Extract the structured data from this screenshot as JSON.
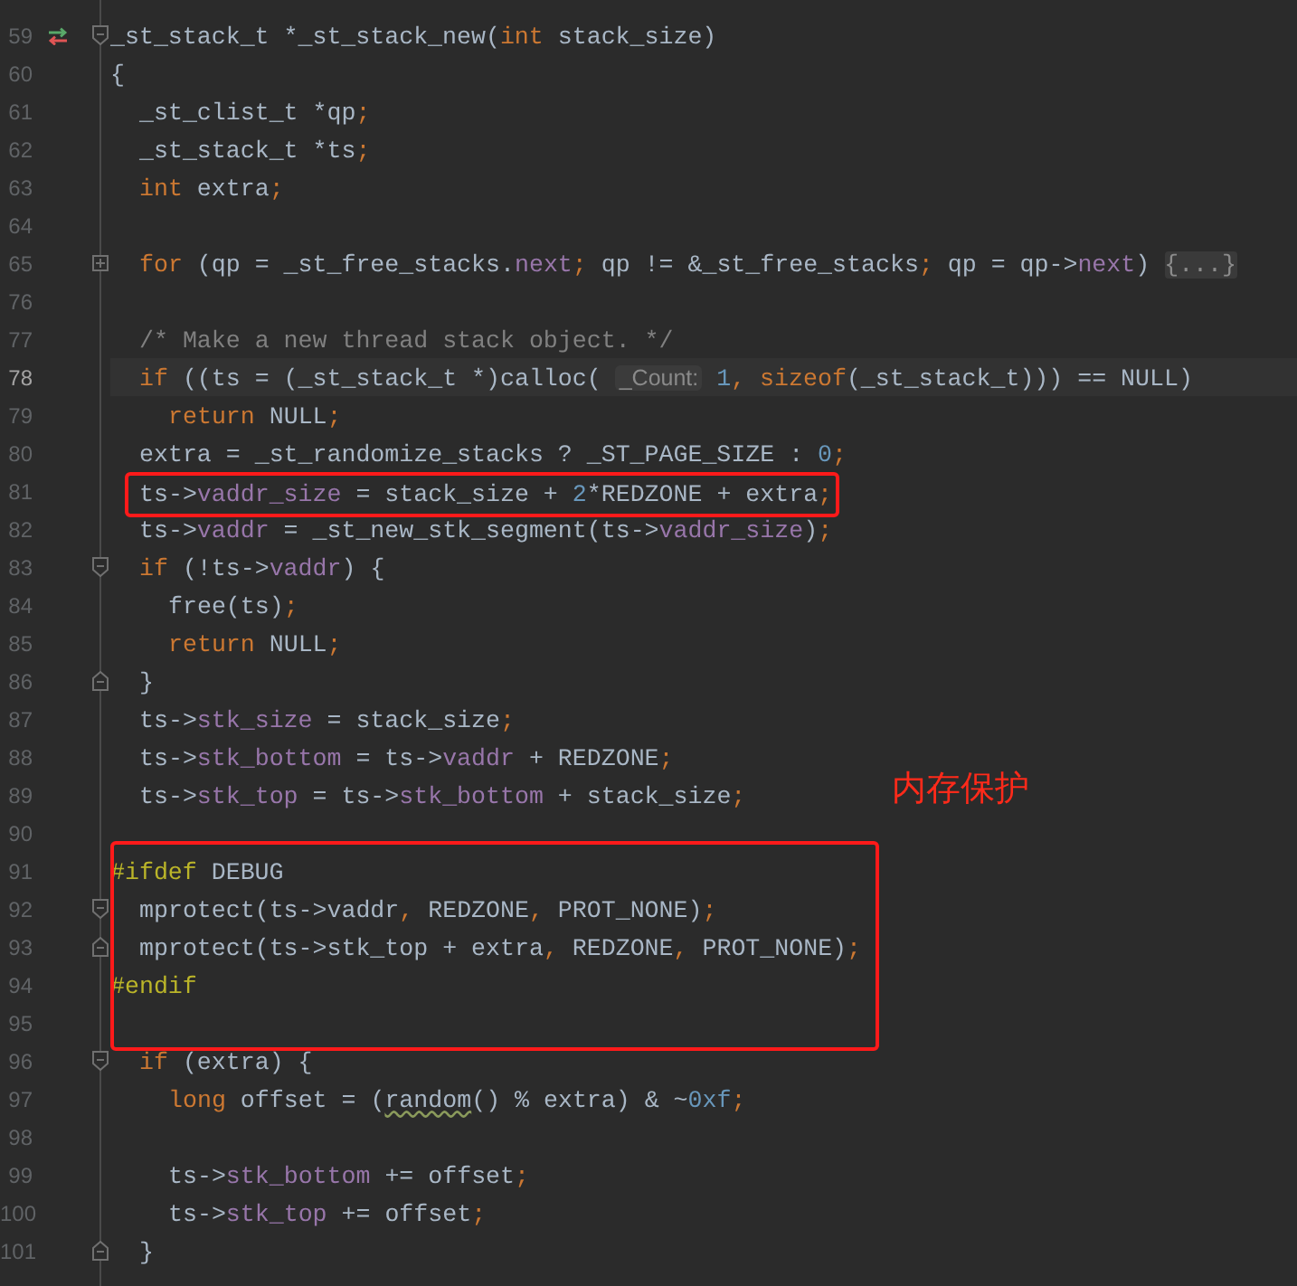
{
  "editor": {
    "groups": [
      {
        "kind": "plain",
        "lines": [
          {
            "number": "59",
            "gutter_icon": {
              "kind": "swap"
            },
            "fold": {
              "kind": "start"
            },
            "current": false,
            "tokens": [
              {
                "kind": "p",
                "text": "_st_stack_t *_st_stack_new("
              },
              {
                "kind": "kw",
                "text": "int"
              },
              {
                "kind": "p",
                "text": " stack_size)"
              }
            ]
          },
          {
            "number": "60",
            "current": false,
            "tokens": [
              {
                "kind": "p",
                "text": "{"
              }
            ]
          },
          {
            "number": "61",
            "current": false,
            "tokens": [
              {
                "kind": "p",
                "text": "  _st_clist_t *qp"
              },
              {
                "kind": "kw",
                "text": ";"
              }
            ]
          },
          {
            "number": "62",
            "current": false,
            "tokens": [
              {
                "kind": "p",
                "text": "  _st_stack_t *ts"
              },
              {
                "kind": "kw",
                "text": ";"
              }
            ]
          },
          {
            "number": "63",
            "current": false,
            "tokens": [
              {
                "kind": "kw",
                "text": "  int"
              },
              {
                "kind": "p",
                "text": " extra"
              },
              {
                "kind": "kw",
                "text": ";"
              }
            ]
          },
          {
            "number": "64",
            "current": false
          },
          {
            "number": "65",
            "fold": {
              "kind": "collapsed"
            },
            "current": false,
            "tokens": [
              {
                "kind": "kw",
                "text": "  for"
              },
              {
                "kind": "p",
                "text": " (qp = _st_free_stacks."
              },
              {
                "kind": "f",
                "text": "next"
              },
              {
                "kind": "kw",
                "text": ";"
              },
              {
                "kind": "p",
                "text": " qp != &_st_free_stacks"
              },
              {
                "kind": "kw",
                "text": ";"
              },
              {
                "kind": "p",
                "text": " qp = qp->"
              },
              {
                "kind": "f",
                "text": "next"
              },
              {
                "kind": "p",
                "text": ") "
              },
              {
                "kind": "ph",
                "text": "{...}"
              }
            ]
          },
          {
            "number": "76",
            "current": false
          },
          {
            "number": "77",
            "current": false,
            "tokens": [
              {
                "kind": "c",
                "text": "  /* Make a new thread stack object. */"
              }
            ]
          },
          {
            "number": "78",
            "current": true,
            "tokens": [
              {
                "kind": "kw",
                "text": "  if"
              },
              {
                "kind": "p",
                "text": " ((ts = (_st_stack_t *)calloc( "
              },
              {
                "kind": "h",
                "text": "_Count:"
              },
              {
                "kind": "n",
                "text": " 1"
              },
              {
                "kind": "kw",
                "text": ","
              },
              {
                "kind": "kw",
                "text": " sizeof"
              },
              {
                "kind": "p",
                "text": "(_st_stack_t))) == NULL)"
              }
            ]
          },
          {
            "number": "79",
            "current": false,
            "tokens": [
              {
                "kind": "kw",
                "text": "    return"
              },
              {
                "kind": "p",
                "text": " NULL"
              },
              {
                "kind": "kw",
                "text": ";"
              }
            ]
          },
          {
            "number": "80",
            "current": false,
            "tokens": [
              {
                "kind": "p",
                "text": "  extra = _st_randomize_stacks ? _ST_PAGE_SIZE : "
              },
              {
                "kind": "n",
                "text": "0"
              },
              {
                "kind": "kw",
                "text": ";"
              }
            ]
          }
        ]
      },
      {
        "kind": "boxed_line",
        "lines": [
          {
            "number": "81",
            "current": false,
            "tokens": [
              {
                "kind": "p",
                "text": "  ts->"
              },
              {
                "kind": "f",
                "text": "vaddr_size"
              },
              {
                "kind": "p",
                "text": " = stack_size + "
              },
              {
                "kind": "n",
                "text": "2"
              },
              {
                "kind": "p",
                "text": "*REDZONE + extra"
              },
              {
                "kind": "kw",
                "text": ";"
              }
            ]
          }
        ]
      },
      {
        "kind": "plain",
        "lines": [
          {
            "number": "82",
            "current": false,
            "tokens": [
              {
                "kind": "p",
                "text": "  ts->"
              },
              {
                "kind": "f",
                "text": "vaddr"
              },
              {
                "kind": "p",
                "text": " = _st_new_stk_segment(ts->"
              },
              {
                "kind": "f",
                "text": "vaddr_size"
              },
              {
                "kind": "p",
                "text": ")"
              },
              {
                "kind": "kw",
                "text": ";"
              }
            ]
          },
          {
            "number": "83",
            "fold": {
              "kind": "start"
            },
            "current": false,
            "tokens": [
              {
                "kind": "kw",
                "text": "  if"
              },
              {
                "kind": "p",
                "text": " (!ts->"
              },
              {
                "kind": "f",
                "text": "vaddr"
              },
              {
                "kind": "p",
                "text": ") {"
              }
            ]
          },
          {
            "number": "84",
            "current": false,
            "tokens": [
              {
                "kind": "p",
                "text": "    free(ts)"
              },
              {
                "kind": "kw",
                "text": ";"
              }
            ]
          },
          {
            "number": "85",
            "current": false,
            "tokens": [
              {
                "kind": "kw",
                "text": "    return"
              },
              {
                "kind": "p",
                "text": " NULL"
              },
              {
                "kind": "kw",
                "text": ";"
              }
            ]
          },
          {
            "number": "86",
            "fold": {
              "kind": "end"
            },
            "current": false,
            "tokens": [
              {
                "kind": "p",
                "text": "  }"
              }
            ]
          },
          {
            "number": "87",
            "current": false,
            "tokens": [
              {
                "kind": "p",
                "text": "  ts->"
              },
              {
                "kind": "f",
                "text": "stk_size"
              },
              {
                "kind": "p",
                "text": " = stack_size"
              },
              {
                "kind": "kw",
                "text": ";"
              }
            ]
          },
          {
            "number": "88",
            "current": false,
            "tokens": [
              {
                "kind": "p",
                "text": "  ts->"
              },
              {
                "kind": "f",
                "text": "stk_bottom"
              },
              {
                "kind": "p",
                "text": " = ts->"
              },
              {
                "kind": "f",
                "text": "vaddr"
              },
              {
                "kind": "p",
                "text": " + REDZONE"
              },
              {
                "kind": "kw",
                "text": ";"
              }
            ]
          },
          {
            "number": "89",
            "current": false,
            "note": "内存保护",
            "tokens": [
              {
                "kind": "p",
                "text": "  ts->"
              },
              {
                "kind": "f",
                "text": "stk_top"
              },
              {
                "kind": "p",
                "text": " = ts->"
              },
              {
                "kind": "f",
                "text": "stk_bottom"
              },
              {
                "kind": "p",
                "text": " + stack_size"
              },
              {
                "kind": "kw",
                "text": ";"
              }
            ]
          },
          {
            "number": "90",
            "current": false
          }
        ]
      },
      {
        "kind": "boxed_block",
        "lines": [
          {
            "number": "91",
            "current": false,
            "tokens": [
              {
                "kind": "m",
                "text": "#ifdef"
              },
              {
                "kind": "p",
                "text": " DEBUG"
              }
            ]
          },
          {
            "number": "92",
            "fold": {
              "kind": "start"
            },
            "current": false,
            "tokens": [
              {
                "kind": "p",
                "text": "  mprotect(ts->vaddr"
              },
              {
                "kind": "kw",
                "text": ","
              },
              {
                "kind": "p",
                "text": " REDZONE"
              },
              {
                "kind": "kw",
                "text": ","
              },
              {
                "kind": "p",
                "text": " PROT_NONE)"
              },
              {
                "kind": "kw",
                "text": ";"
              }
            ]
          },
          {
            "number": "93",
            "fold": {
              "kind": "end"
            },
            "current": false,
            "tokens": [
              {
                "kind": "p",
                "text": "  mprotect(ts->stk_top + extra"
              },
              {
                "kind": "kw",
                "text": ","
              },
              {
                "kind": "p",
                "text": " REDZONE"
              },
              {
                "kind": "kw",
                "text": ","
              },
              {
                "kind": "p",
                "text": " PROT_NONE)"
              },
              {
                "kind": "kw",
                "text": ";"
              }
            ]
          },
          {
            "number": "94",
            "current": false,
            "tokens": [
              {
                "kind": "m",
                "text": "#endif"
              }
            ]
          },
          {
            "number": "95",
            "current": false
          }
        ]
      },
      {
        "kind": "plain",
        "lines": [
          {
            "number": "96",
            "fold": {
              "kind": "start"
            },
            "current": false,
            "tokens": [
              {
                "kind": "kw",
                "text": "  if"
              },
              {
                "kind": "p",
                "text": " (extra) {"
              }
            ]
          },
          {
            "number": "97",
            "current": false,
            "tokens": [
              {
                "kind": "kw",
                "text": "    long"
              },
              {
                "kind": "p",
                "text": " offset = ("
              },
              {
                "kind": "w",
                "text": "random"
              },
              {
                "kind": "p",
                "text": "() % extra) & ~"
              },
              {
                "kind": "n",
                "text": "0xf"
              },
              {
                "kind": "kw",
                "text": ";"
              }
            ]
          },
          {
            "number": "98",
            "current": false
          },
          {
            "number": "99",
            "current": false,
            "tokens": [
              {
                "kind": "p",
                "text": "    ts->"
              },
              {
                "kind": "f",
                "text": "stk_bottom"
              },
              {
                "kind": "p",
                "text": " += offset"
              },
              {
                "kind": "kw",
                "text": ";"
              }
            ]
          },
          {
            "number": "100",
            "current": false,
            "tokens": [
              {
                "kind": "p",
                "text": "    ts->"
              },
              {
                "kind": "f",
                "text": "stk_top"
              },
              {
                "kind": "p",
                "text": " += offset"
              },
              {
                "kind": "kw",
                "text": ";"
              }
            ]
          },
          {
            "number": "101",
            "fold": {
              "kind": "end"
            },
            "current": false,
            "tokens": [
              {
                "kind": "p",
                "text": "  }"
              }
            ]
          }
        ]
      }
    ]
  }
}
